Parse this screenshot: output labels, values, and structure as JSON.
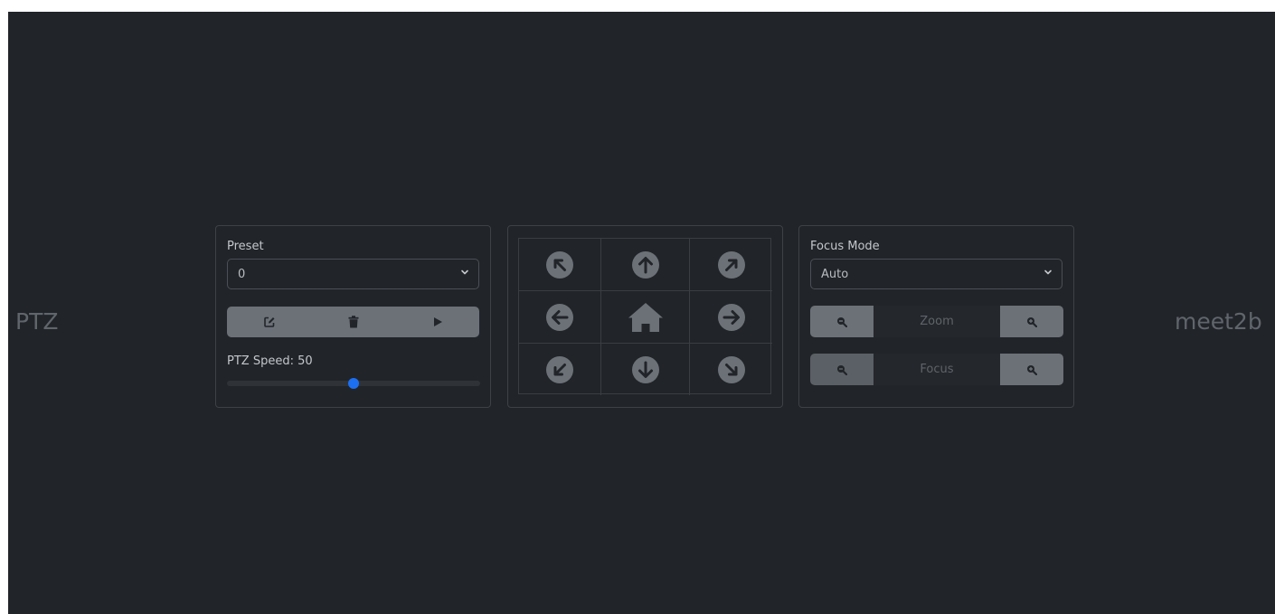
{
  "left_label": "PTZ",
  "right_label": "meet2b",
  "preset_panel": {
    "label": "Preset",
    "selected": "0",
    "speed_label": "PTZ Speed: 50",
    "speed_value": 50,
    "speed_max": 100,
    "icons": [
      "edit-icon",
      "trash-icon",
      "play-icon"
    ]
  },
  "dpad": {
    "cells": [
      "arrow-up-left-icon",
      "arrow-up-icon",
      "arrow-up-right-icon",
      "arrow-left-icon",
      "home-icon",
      "arrow-right-icon",
      "arrow-down-left-icon",
      "arrow-down-icon",
      "arrow-down-right-icon"
    ]
  },
  "focus_panel": {
    "label": "Focus Mode",
    "selected": "Auto",
    "zoom_label": "Zoom",
    "focus_label": "Focus"
  },
  "colors": {
    "background": "#212429",
    "button": "#6c7178",
    "slider_thumb": "#1d6ff2",
    "icon_fill": "#212429"
  }
}
